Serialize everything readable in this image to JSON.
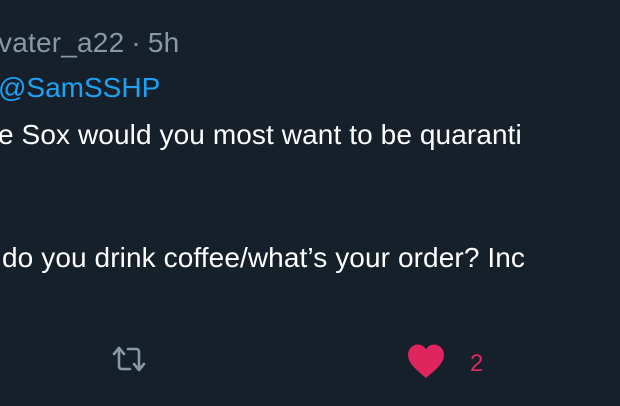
{
  "tweet": {
    "handle": "vater_a22",
    "separator": "·",
    "time": "5h",
    "reply_mention": "@SamSSHP",
    "line1": "e Sox would you most want to be quaranti",
    "line2": "do you drink coffee/what’s your order? Inc",
    "actions": {
      "retweet_icon": "retweet-icon",
      "like_icon": "heart-icon",
      "like_count": "2"
    }
  },
  "colors": {
    "background": "#15202b",
    "muted": "#8899a6",
    "link": "#1da1f2",
    "text": "#ffffff",
    "like": "#e0245e"
  }
}
